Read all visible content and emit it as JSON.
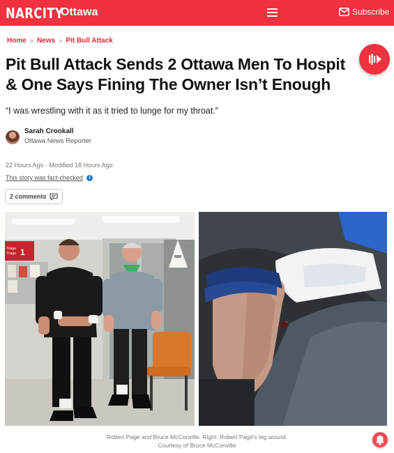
{
  "header": {
    "logo": "NARCITY",
    "city": "Ottawa",
    "menu_icon": "hamburger-icon",
    "subscribe_label": "Subscribe",
    "subscribe_icon": "mail-icon",
    "brand_color": "#f0313f"
  },
  "breadcrumb": {
    "items": [
      "Home",
      "News",
      "Pit Bull Attack"
    ]
  },
  "article": {
    "headline_line1": "Pit Bull Attack Sends 2 Ottawa Men To Hospit",
    "headline_line2": "& One Says Fining The Owner Isn’t Enough",
    "dek": "“I was wrestling with it as it tried to lunge for my throat.”",
    "author_name": "Sarah Crookall",
    "author_role": "Ottawa News Reporter",
    "published": "22 Hours Ago",
    "modified": "· Modified 18 Hours Ago",
    "fact_check": "This story was fact-checked",
    "info_icon": "info-icon",
    "comments_label": "2 comments",
    "comments_icon": "comment-icon",
    "play_icon": "audio-play-icon"
  },
  "photos": {
    "left_sign_text": "Triage\nTriage 1",
    "caption_line1": "Robert Pagé and Bruce McConville. Right: Robert Pagé's leg wound.",
    "caption_line2": "Courtesy of Bruce McConville"
  },
  "notification": {
    "icon": "bell-icon",
    "color": "#f24b55"
  }
}
